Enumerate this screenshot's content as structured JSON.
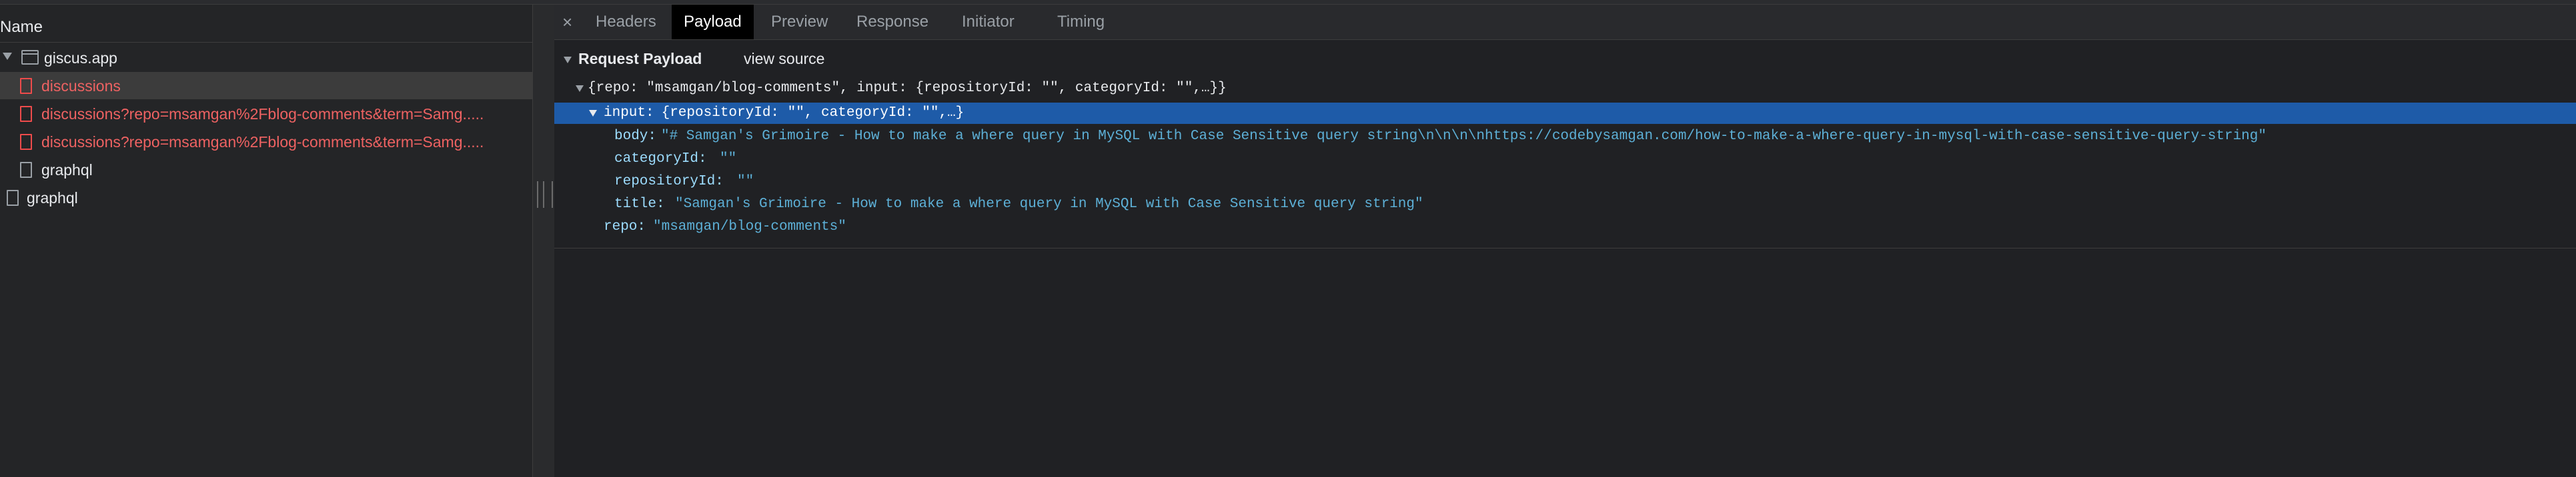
{
  "network_list": {
    "header": "Name",
    "items": [
      {
        "label": "giscus.app",
        "type": "frame",
        "indent": 0,
        "error": false,
        "expanded": true
      },
      {
        "label": "discussions",
        "type": "doc",
        "indent": 1,
        "error": true,
        "selected": true
      },
      {
        "label": "discussions?repo=msamgan%2Fblog-comments&term=Samg.....",
        "type": "doc",
        "indent": 1,
        "error": true
      },
      {
        "label": "discussions?repo=msamgan%2Fblog-comments&term=Samg.....",
        "type": "doc",
        "indent": 1,
        "error": true
      },
      {
        "label": "graphql",
        "type": "doc",
        "indent": 1,
        "error": false
      },
      {
        "label": "graphql",
        "type": "doc",
        "indent": 0,
        "error": false
      }
    ]
  },
  "tabs": {
    "close_glyph": "×",
    "items": [
      "Headers",
      "Payload",
      "Preview",
      "Response",
      "Initiator",
      "Timing"
    ],
    "active": "Payload"
  },
  "payload": {
    "section_title": "Request Payload",
    "view_source_label": "view source",
    "root_summary": "{repo: \"msamgan/blog-comments\", input: {repositoryId: \"\", categoryId: \"\",…}}",
    "input_key": "input:",
    "input_summary": " {repositoryId: \"\", categoryId: \"\",…}",
    "fields": [
      {
        "key": "body:",
        "value": "\"# Samgan's Grimoire - How to make a where query in MySQL with Case Sensitive query string\\n\\n\\n\\nhttps://codebysamgan.com/how-to-make-a-where-query-in-mysql-with-case-sensitive-query-string\""
      },
      {
        "key": "categoryId:",
        "value": "\"\""
      },
      {
        "key": "repositoryId:",
        "value": "\"\""
      },
      {
        "key": "title:",
        "value": "\"Samgan's Grimoire - How to make a where query in MySQL with Case Sensitive query string\""
      }
    ],
    "repo_key": "repo:",
    "repo_value": "\"msamgan/blog-comments\""
  },
  "colors": {
    "background": "#202124",
    "selection": "#1e5ba8",
    "error_text": "#ee6262",
    "string_value": "#5db0d7",
    "key": "#9cdcfe"
  }
}
